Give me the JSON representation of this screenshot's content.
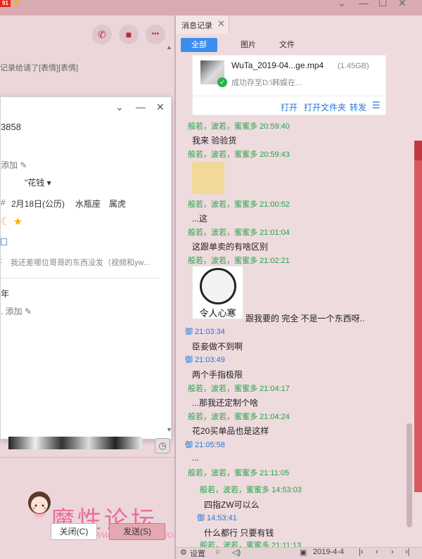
{
  "titlebar": {
    "app_badge": "91",
    "window_controls": [
      "⌄",
      "—",
      "☐",
      "✕"
    ]
  },
  "chat": {
    "buttons": [
      {
        "icon": "phone-icon",
        "glyph": "✆"
      },
      {
        "icon": "video-icon",
        "glyph": "■"
      },
      {
        "icon": "more-icon",
        "glyph": "•••"
      }
    ],
    "preview": "记录给请了[表情][表情]"
  },
  "profile": {
    "controls": [
      "⌄",
      "—",
      "✕"
    ],
    "id": "3858",
    "add_label": "添加",
    "nickname": "\"花钱",
    "birthday": "2月18日(公历)",
    "zodiac": "水瓶座",
    "chinese_zodiac": "属虎",
    "signature": "我还差哪位哥哥的东西没发（视频和yw...",
    "year_label": "年",
    "add_label2": "添加"
  },
  "footer": {
    "close_label": "关闭(C)",
    "send_label": "发送(S)",
    "logo_text": "魔性论坛",
    "logo_url": "www.moxing.cool"
  },
  "history": {
    "tab_label": "消息记录",
    "filters": [
      "全部",
      "图片",
      "文件"
    ],
    "file": {
      "name": "WuTa_2019-04...ge.mp4",
      "size": "(1.45GB)",
      "status": "成功存至D:\\韩娱在...",
      "actions": [
        "打开",
        "打开文件夹",
        "转发"
      ]
    },
    "messages": [
      {
        "sender": "般若，波若，蜜蜜多",
        "time": "20:59:40",
        "text": "我来 验验货",
        "self": false
      },
      {
        "sender": "般若，波若，蜜蜜多",
        "time": "20:59:43",
        "text": "",
        "self": false,
        "sticker": "book-sticker"
      },
      {
        "sender": "般若，波若，蜜蜜多",
        "time": "21:00:52",
        "text": "...这",
        "self": false
      },
      {
        "sender": "般若，波若，蜜蜜多",
        "time": "21:01:04",
        "text": "这跟单卖的有啥区别",
        "self": false
      },
      {
        "sender": "般若，波若，蜜蜜多",
        "time": "21:02:21",
        "text": "跟我要的 完全 不是一个东西呀..",
        "self": false,
        "sticker_caption": "令人心寒"
      },
      {
        "sender": "御",
        "time": "21:03:34",
        "text": "臣妾做不到啊",
        "self": true
      },
      {
        "sender": "御",
        "time": "21:03:49",
        "text": "两个手指极限",
        "self": true
      },
      {
        "sender": "般若，波若，蜜蜜多",
        "time": "21:04:17",
        "text": "...那我还定制个啥",
        "self": false
      },
      {
        "sender": "般若，波若，蜜蜜多",
        "time": "21:04:24",
        "text": "花20买单品也是这样",
        "self": false
      },
      {
        "sender": "御",
        "time": "21:05:58",
        "text": "...",
        "self": true
      },
      {
        "sender": "般若，波若，蜜蜜多",
        "time": "21:11:05",
        "text": "",
        "self": false
      },
      {
        "sender": "般若，波若，蜜蜜多",
        "time": "14:53:03",
        "text": "四指ZW可以么",
        "self": false
      },
      {
        "sender": "御",
        "time": "14:53:41",
        "text": "什么都行 只要有钱",
        "self": true
      },
      {
        "sender": "般若，波若，蜜蜜多",
        "time": "21:11:13",
        "text": "",
        "self": false
      }
    ],
    "bottom": {
      "settings_label": "设置",
      "date": "2019-4-4"
    }
  }
}
